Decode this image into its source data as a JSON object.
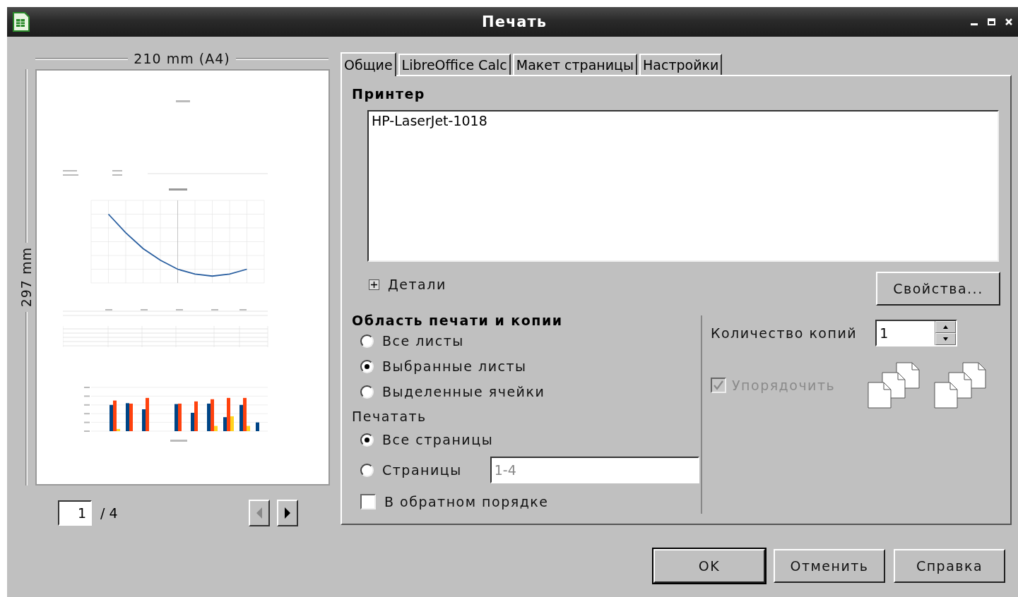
{
  "window": {
    "title": "Печать"
  },
  "preview": {
    "width_label": "210 mm (A4)",
    "height_label": "297 mm",
    "page_number": "1",
    "page_total": "/ 4",
    "prev_disabled": true,
    "next_disabled": false
  },
  "tabs": [
    {
      "label": "Общие",
      "selected": true
    },
    {
      "label": "LibreOffice Calc",
      "selected": false
    },
    {
      "label": "Макет страницы",
      "selected": false
    },
    {
      "label": "Настройки",
      "selected": false
    }
  ],
  "printer": {
    "heading": "Принтер",
    "items": [
      {
        "name": "HP-LaserJet-1018",
        "selected": false
      }
    ],
    "details": {
      "label": "Детали",
      "expanded": false
    },
    "properties_button": "Свойства..."
  },
  "range": {
    "heading": "Область печати и копии",
    "options": [
      {
        "label": "Все листы",
        "selected": false
      },
      {
        "label": "Выбранные листы",
        "selected": true
      },
      {
        "label": "Выделенные ячейки",
        "selected": false
      }
    ],
    "print_label": "Печатать",
    "pages": [
      {
        "label": "Все страницы",
        "selected": true
      },
      {
        "label": "Страницы",
        "selected": false
      }
    ],
    "pages_field": {
      "value": "1-4",
      "disabled": true
    },
    "reverse": {
      "label": "В обратном порядке",
      "checked": false
    }
  },
  "copies": {
    "label": "Количество копий",
    "value": "1",
    "collate": {
      "label": "Упорядочить",
      "checked": true,
      "disabled": true
    }
  },
  "buttons": [
    {
      "label": "OK",
      "default": true
    },
    {
      "label": "Отменить",
      "default": false
    },
    {
      "label": "Справка",
      "default": false
    }
  ]
}
